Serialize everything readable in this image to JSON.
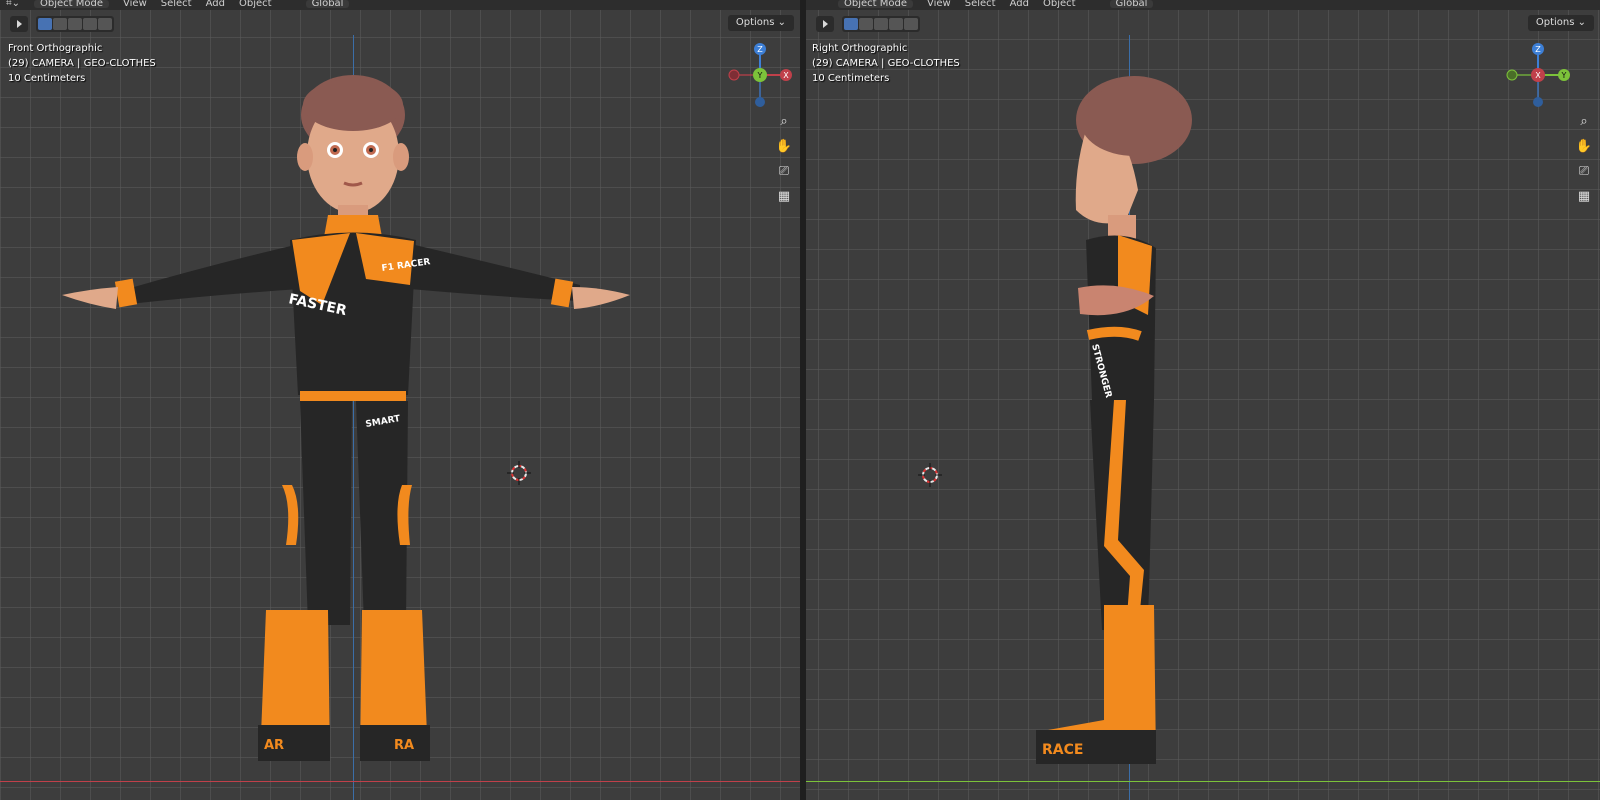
{
  "left_view": {
    "header": {
      "mode": "Object Mode",
      "menus": [
        "View",
        "Select",
        "Add",
        "Object"
      ],
      "orientation": "Global"
    },
    "options_label": "Options",
    "overlay": {
      "view_name": "Front Orthographic",
      "collection": "(29) CAMERA | GEO-CLOTHES",
      "scale": "10 Centimeters"
    },
    "gizmo": {
      "top": "Z",
      "center": "Y",
      "right": "X"
    },
    "decals": [
      "F1 RACER",
      "FASTER",
      "SMART",
      "AR",
      "RA"
    ]
  },
  "right_view": {
    "header": {
      "mode": "Object Mode",
      "menus": [
        "View",
        "Select",
        "Add",
        "Object"
      ],
      "orientation": "Global"
    },
    "options_label": "Options",
    "overlay": {
      "view_name": "Right Orthographic",
      "collection": "(29) CAMERA | GEO-CLOTHES",
      "scale": "10 Centimeters"
    },
    "gizmo": {
      "top": "Z",
      "center": "X",
      "right": "Y"
    },
    "decals": [
      "STRONGER",
      "RACE"
    ]
  },
  "navigation_icons": [
    "zoom-icon",
    "pan-hand-icon",
    "camera-icon",
    "grid-icon"
  ],
  "colors": {
    "suit_orange": "#f28a1e",
    "suit_black": "#262626",
    "skin": "#e0a98a",
    "hair": "#8a5a52",
    "axis_x": "#c0404a",
    "axis_y": "#7cc23a",
    "axis_z": "#3d7fd6",
    "selection_blue": "#4772b3"
  }
}
